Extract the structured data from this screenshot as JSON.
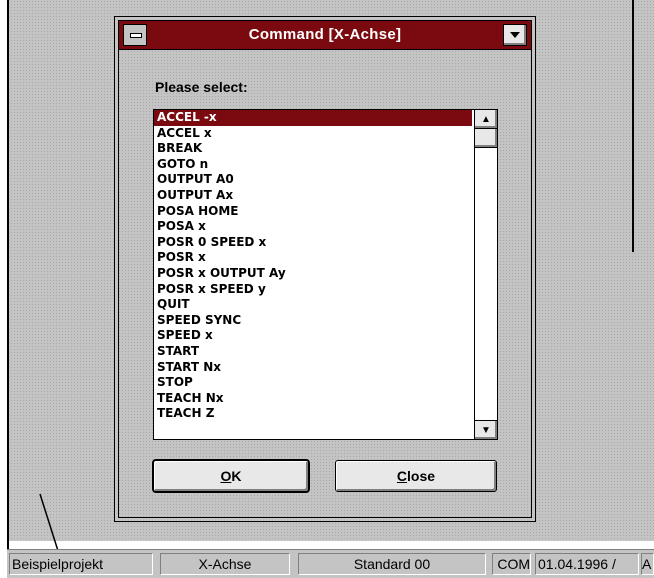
{
  "dialog": {
    "title": "Command [X-Achse]",
    "prompt": "Please select:",
    "items": [
      "ACCEL -x",
      "ACCEL x",
      "BREAK",
      "GOTO n",
      "OUTPUT A0",
      "OUTPUT Ax",
      "POSA HOME",
      "POSA x",
      "POSR 0 SPEED x",
      "POSR x",
      "POSR x OUTPUT Ay",
      "POSR x SPEED y",
      "QUIT",
      "SPEED SYNC",
      "SPEED x",
      "START",
      "START Nx",
      "STOP",
      "TEACH Nx",
      "TEACH Z"
    ],
    "selected_index": 0,
    "ok_button": {
      "mnemonic": "O",
      "rest": "K"
    },
    "close_button": {
      "mnemonic": "C",
      "rest": "lose"
    },
    "scroll_up_icon": "▲",
    "scroll_down_icon": "▼"
  },
  "statusbar": {
    "project": "Beispielprojekt",
    "axis": "X-Achse",
    "standard": "Standard 00",
    "port": "COM",
    "date": "01.04.1996 /",
    "extra": "A"
  },
  "colors": {
    "titlebar": "#7a0a10",
    "selection": "#7a0a10",
    "face": "#c4c4c4"
  }
}
